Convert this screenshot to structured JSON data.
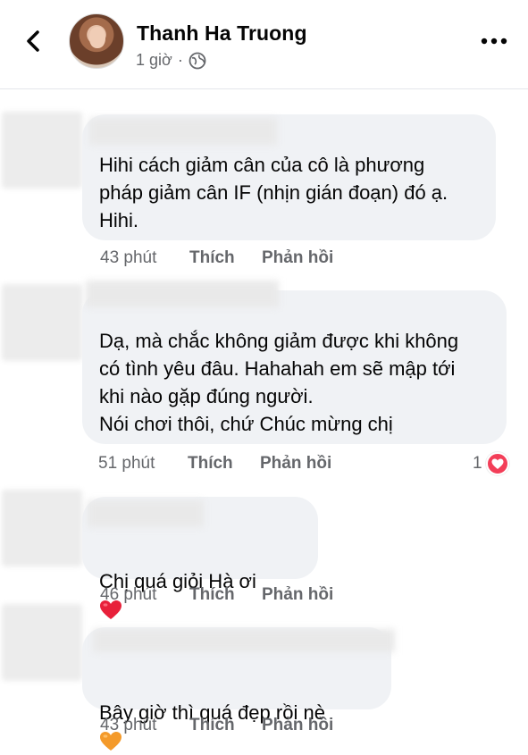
{
  "header": {
    "author": "Thanh Ha Truong",
    "time": "1 giờ",
    "separator": "·",
    "privacy_icon": "globe-icon",
    "back_icon": "chevron-left-icon",
    "more_icon": "more-dots-icon"
  },
  "comments": [
    {
      "text": "Hihi cách giảm cân của cô là phương\npháp giảm cân IF (nhịn gián đoạn) đó ạ.\nHihi.",
      "time": "43 phút",
      "like": "Thích",
      "reply": "Phản hồi"
    },
    {
      "text": "Dạ, mà chắc không giảm được khi không\ncó tình yêu đâu. Hahahah em sẽ mập tới\nkhi nào gặp đúng người.\nNói chơi thôi, chứ Chúc mừng chị",
      "time": "51 phút",
      "like": "Thích",
      "reply": "Phản hồi",
      "reaction_count": "1",
      "reaction_icon": "heart-reaction-icon"
    },
    {
      "text": "Chị quá giỏi Hà ơi",
      "emoji": "red-heart-emoji",
      "time": "46 phút",
      "like": "Thích",
      "reply": "Phản hồi"
    },
    {
      "text": "Bây giờ thì quá đẹp rồi nè",
      "emoji": "orange-heart-emoji",
      "time": "43 phút",
      "like": "Thích",
      "reply": "Phản hồi"
    }
  ],
  "colors": {
    "bubble": "#f0f2f5",
    "meta_text": "#65676b",
    "heart_red": "#f33e58",
    "heart_orange": "#f7a335"
  }
}
